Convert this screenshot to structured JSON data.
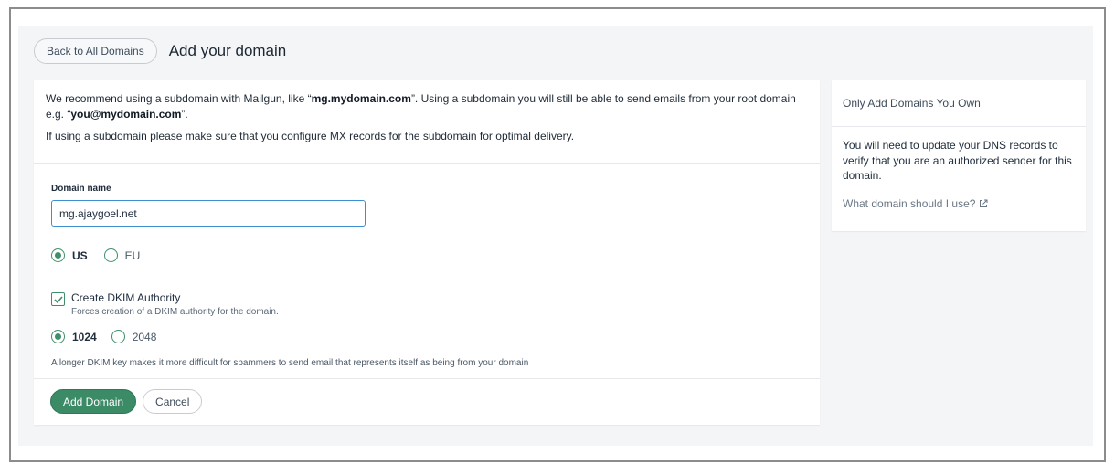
{
  "header": {
    "back_label": "Back to All Domains",
    "title": "Add your domain"
  },
  "intro": {
    "line1_a": "We recommend using a subdomain with Mailgun, like “",
    "line1_bold1": "mg.mydomain.com",
    "line1_b": "”. Using a subdomain you will still be able to send emails from your root domain e.g. “",
    "line1_bold2": "you@mydomain.com",
    "line1_c": "”.",
    "line2": "If using a subdomain please make sure that you configure MX records for the subdomain for optimal delivery."
  },
  "form": {
    "domain_label": "Domain name",
    "domain_value": "mg.ajaygoel.net",
    "region_options": [
      {
        "label": "US",
        "selected": true
      },
      {
        "label": "EU",
        "selected": false
      }
    ],
    "dkim": {
      "checked": true,
      "label": "Create DKIM Authority",
      "sublabel": "Forces creation of a DKIM authority for the domain."
    },
    "key_options": [
      {
        "label": "1024",
        "selected": true
      },
      {
        "label": "2048",
        "selected": false
      }
    ],
    "key_help": "A longer DKIM key makes it more difficult for spammers to send email that represents itself as being from your domain"
  },
  "actions": {
    "add_label": "Add Domain",
    "cancel_label": "Cancel"
  },
  "side": {
    "title": "Only Add Domains You Own",
    "body": "You will need to update your DNS records to verify that you are an authorized sender for this domain.",
    "link": "What domain should I use?",
    "link_icon": "external-link-icon"
  },
  "colors": {
    "accent_green": "#3a8b66",
    "input_focus_blue": "#3d8fd1",
    "page_bg": "#f4f5f7"
  }
}
